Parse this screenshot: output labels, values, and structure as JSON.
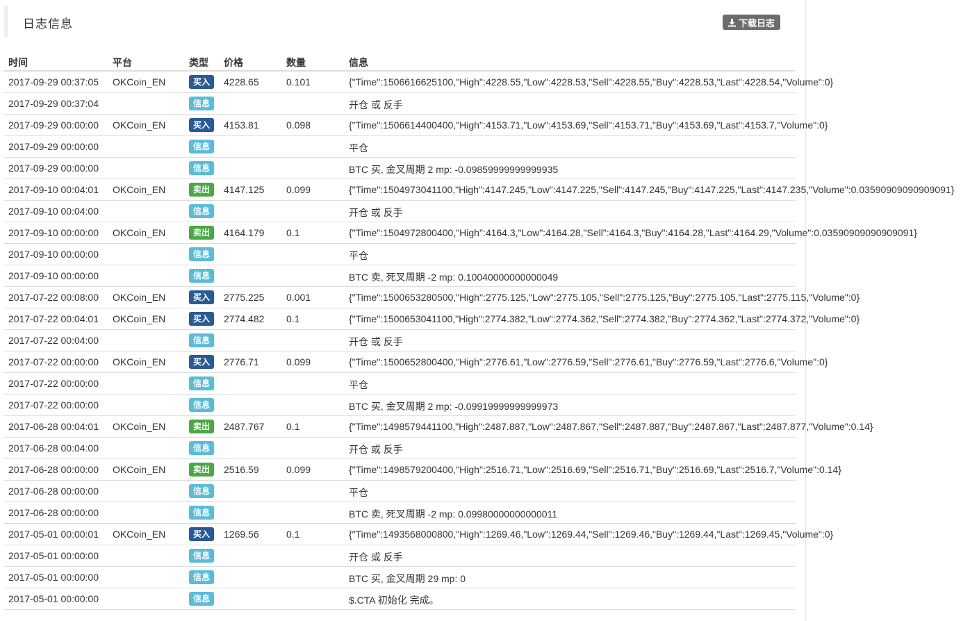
{
  "panel": {
    "title": "日志信息",
    "download_label": "下载日志",
    "download_icon": "download-icon"
  },
  "colors": {
    "buy": "#2a5a96",
    "sell": "#4aa845",
    "info": "#5bbcd8"
  },
  "columns": [
    "时间",
    "平台",
    "类型",
    "价格",
    "数量",
    "信息"
  ],
  "rows": [
    {
      "time": "2017-09-29 00:37:05",
      "platform": "OKCoin_EN",
      "type": "买入",
      "kind": "buy",
      "price": "4228.65",
      "qty": "0.101",
      "msg": "{\"Time\":1506616625100,\"High\":4228.55,\"Low\":4228.53,\"Sell\":4228.55,\"Buy\":4228.53,\"Last\":4228.54,\"Volume\":0}"
    },
    {
      "time": "2017-09-29 00:37:04",
      "platform": "",
      "type": "信息",
      "kind": "info",
      "price": "",
      "qty": "",
      "msg": "开仓 或 反手"
    },
    {
      "time": "2017-09-29 00:00:00",
      "platform": "OKCoin_EN",
      "type": "买入",
      "kind": "buy",
      "price": "4153.81",
      "qty": "0.098",
      "msg": "{\"Time\":1506614400400,\"High\":4153.71,\"Low\":4153.69,\"Sell\":4153.71,\"Buy\":4153.69,\"Last\":4153.7,\"Volume\":0}"
    },
    {
      "time": "2017-09-29 00:00:00",
      "platform": "",
      "type": "信息",
      "kind": "info",
      "price": "",
      "qty": "",
      "msg": "平仓"
    },
    {
      "time": "2017-09-29 00:00:00",
      "platform": "",
      "type": "信息",
      "kind": "info",
      "price": "",
      "qty": "",
      "msg": "BTC 买, 金叉周期 2 mp: -0.09859999999999935"
    },
    {
      "time": "2017-09-10 00:04:01",
      "platform": "OKCoin_EN",
      "type": "卖出",
      "kind": "sell",
      "price": "4147.125",
      "qty": "0.099",
      "msg": "{\"Time\":1504973041100,\"High\":4147.245,\"Low\":4147.225,\"Sell\":4147.245,\"Buy\":4147.225,\"Last\":4147.235,\"Volume\":0.03590909090909091}"
    },
    {
      "time": "2017-09-10 00:04:00",
      "platform": "",
      "type": "信息",
      "kind": "info",
      "price": "",
      "qty": "",
      "msg": "开仓 或 反手"
    },
    {
      "time": "2017-09-10 00:00:00",
      "platform": "OKCoin_EN",
      "type": "卖出",
      "kind": "sell",
      "price": "4164.179",
      "qty": "0.1",
      "msg": "{\"Time\":1504972800400,\"High\":4164.3,\"Low\":4164.28,\"Sell\":4164.3,\"Buy\":4164.28,\"Last\":4164.29,\"Volume\":0.03590909090909091}"
    },
    {
      "time": "2017-09-10 00:00:00",
      "platform": "",
      "type": "信息",
      "kind": "info",
      "price": "",
      "qty": "",
      "msg": "平仓"
    },
    {
      "time": "2017-09-10 00:00:00",
      "platform": "",
      "type": "信息",
      "kind": "info",
      "price": "",
      "qty": "",
      "msg": "BTC 卖, 死叉周期 -2 mp: 0.10040000000000049"
    },
    {
      "time": "2017-07-22 00:08:00",
      "platform": "OKCoin_EN",
      "type": "买入",
      "kind": "buy",
      "price": "2775.225",
      "qty": "0.001",
      "msg": "{\"Time\":1500653280500,\"High\":2775.125,\"Low\":2775.105,\"Sell\":2775.125,\"Buy\":2775.105,\"Last\":2775.115,\"Volume\":0}"
    },
    {
      "time": "2017-07-22 00:04:01",
      "platform": "OKCoin_EN",
      "type": "买入",
      "kind": "buy",
      "price": "2774.482",
      "qty": "0.1",
      "msg": "{\"Time\":1500653041100,\"High\":2774.382,\"Low\":2774.362,\"Sell\":2774.382,\"Buy\":2774.362,\"Last\":2774.372,\"Volume\":0}"
    },
    {
      "time": "2017-07-22 00:04:00",
      "platform": "",
      "type": "信息",
      "kind": "info",
      "price": "",
      "qty": "",
      "msg": "开仓 或 反手"
    },
    {
      "time": "2017-07-22 00:00:00",
      "platform": "OKCoin_EN",
      "type": "买入",
      "kind": "buy",
      "price": "2776.71",
      "qty": "0.099",
      "msg": "{\"Time\":1500652800400,\"High\":2776.61,\"Low\":2776.59,\"Sell\":2776.61,\"Buy\":2776.59,\"Last\":2776.6,\"Volume\":0}"
    },
    {
      "time": "2017-07-22 00:00:00",
      "platform": "",
      "type": "信息",
      "kind": "info",
      "price": "",
      "qty": "",
      "msg": "平仓"
    },
    {
      "time": "2017-07-22 00:00:00",
      "platform": "",
      "type": "信息",
      "kind": "info",
      "price": "",
      "qty": "",
      "msg": "BTC 买, 金叉周期 2 mp: -0.09919999999999973"
    },
    {
      "time": "2017-06-28 00:04:01",
      "platform": "OKCoin_EN",
      "type": "卖出",
      "kind": "sell",
      "price": "2487.767",
      "qty": "0.1",
      "msg": "{\"Time\":1498579441100,\"High\":2487.887,\"Low\":2487.867,\"Sell\":2487.887,\"Buy\":2487.867,\"Last\":2487.877,\"Volume\":0.14}"
    },
    {
      "time": "2017-06-28 00:04:00",
      "platform": "",
      "type": "信息",
      "kind": "info",
      "price": "",
      "qty": "",
      "msg": "开仓 或 反手"
    },
    {
      "time": "2017-06-28 00:00:00",
      "platform": "OKCoin_EN",
      "type": "卖出",
      "kind": "sell",
      "price": "2516.59",
      "qty": "0.099",
      "msg": "{\"Time\":1498579200400,\"High\":2516.71,\"Low\":2516.69,\"Sell\":2516.71,\"Buy\":2516.69,\"Last\":2516.7,\"Volume\":0.14}"
    },
    {
      "time": "2017-06-28 00:00:00",
      "platform": "",
      "type": "信息",
      "kind": "info",
      "price": "",
      "qty": "",
      "msg": "平仓"
    },
    {
      "time": "2017-06-28 00:00:00",
      "platform": "",
      "type": "信息",
      "kind": "info",
      "price": "",
      "qty": "",
      "msg": "BTC 卖, 死叉周期 -2 mp: 0.09980000000000011"
    },
    {
      "time": "2017-05-01 00:00:01",
      "platform": "OKCoin_EN",
      "type": "买入",
      "kind": "buy",
      "price": "1269.56",
      "qty": "0.1",
      "msg": "{\"Time\":1493568000800,\"High\":1269.46,\"Low\":1269.44,\"Sell\":1269.46,\"Buy\":1269.44,\"Last\":1269.45,\"Volume\":0}"
    },
    {
      "time": "2017-05-01 00:00:00",
      "platform": "",
      "type": "信息",
      "kind": "info",
      "price": "",
      "qty": "",
      "msg": "开仓 或 反手"
    },
    {
      "time": "2017-05-01 00:00:00",
      "platform": "",
      "type": "信息",
      "kind": "info",
      "price": "",
      "qty": "",
      "msg": "BTC 买, 金叉周期 29 mp: 0"
    },
    {
      "time": "2017-05-01 00:00:00",
      "platform": "",
      "type": "信息",
      "kind": "info",
      "price": "",
      "qty": "",
      "msg": "$.CTA 初始化 完成。"
    }
  ]
}
